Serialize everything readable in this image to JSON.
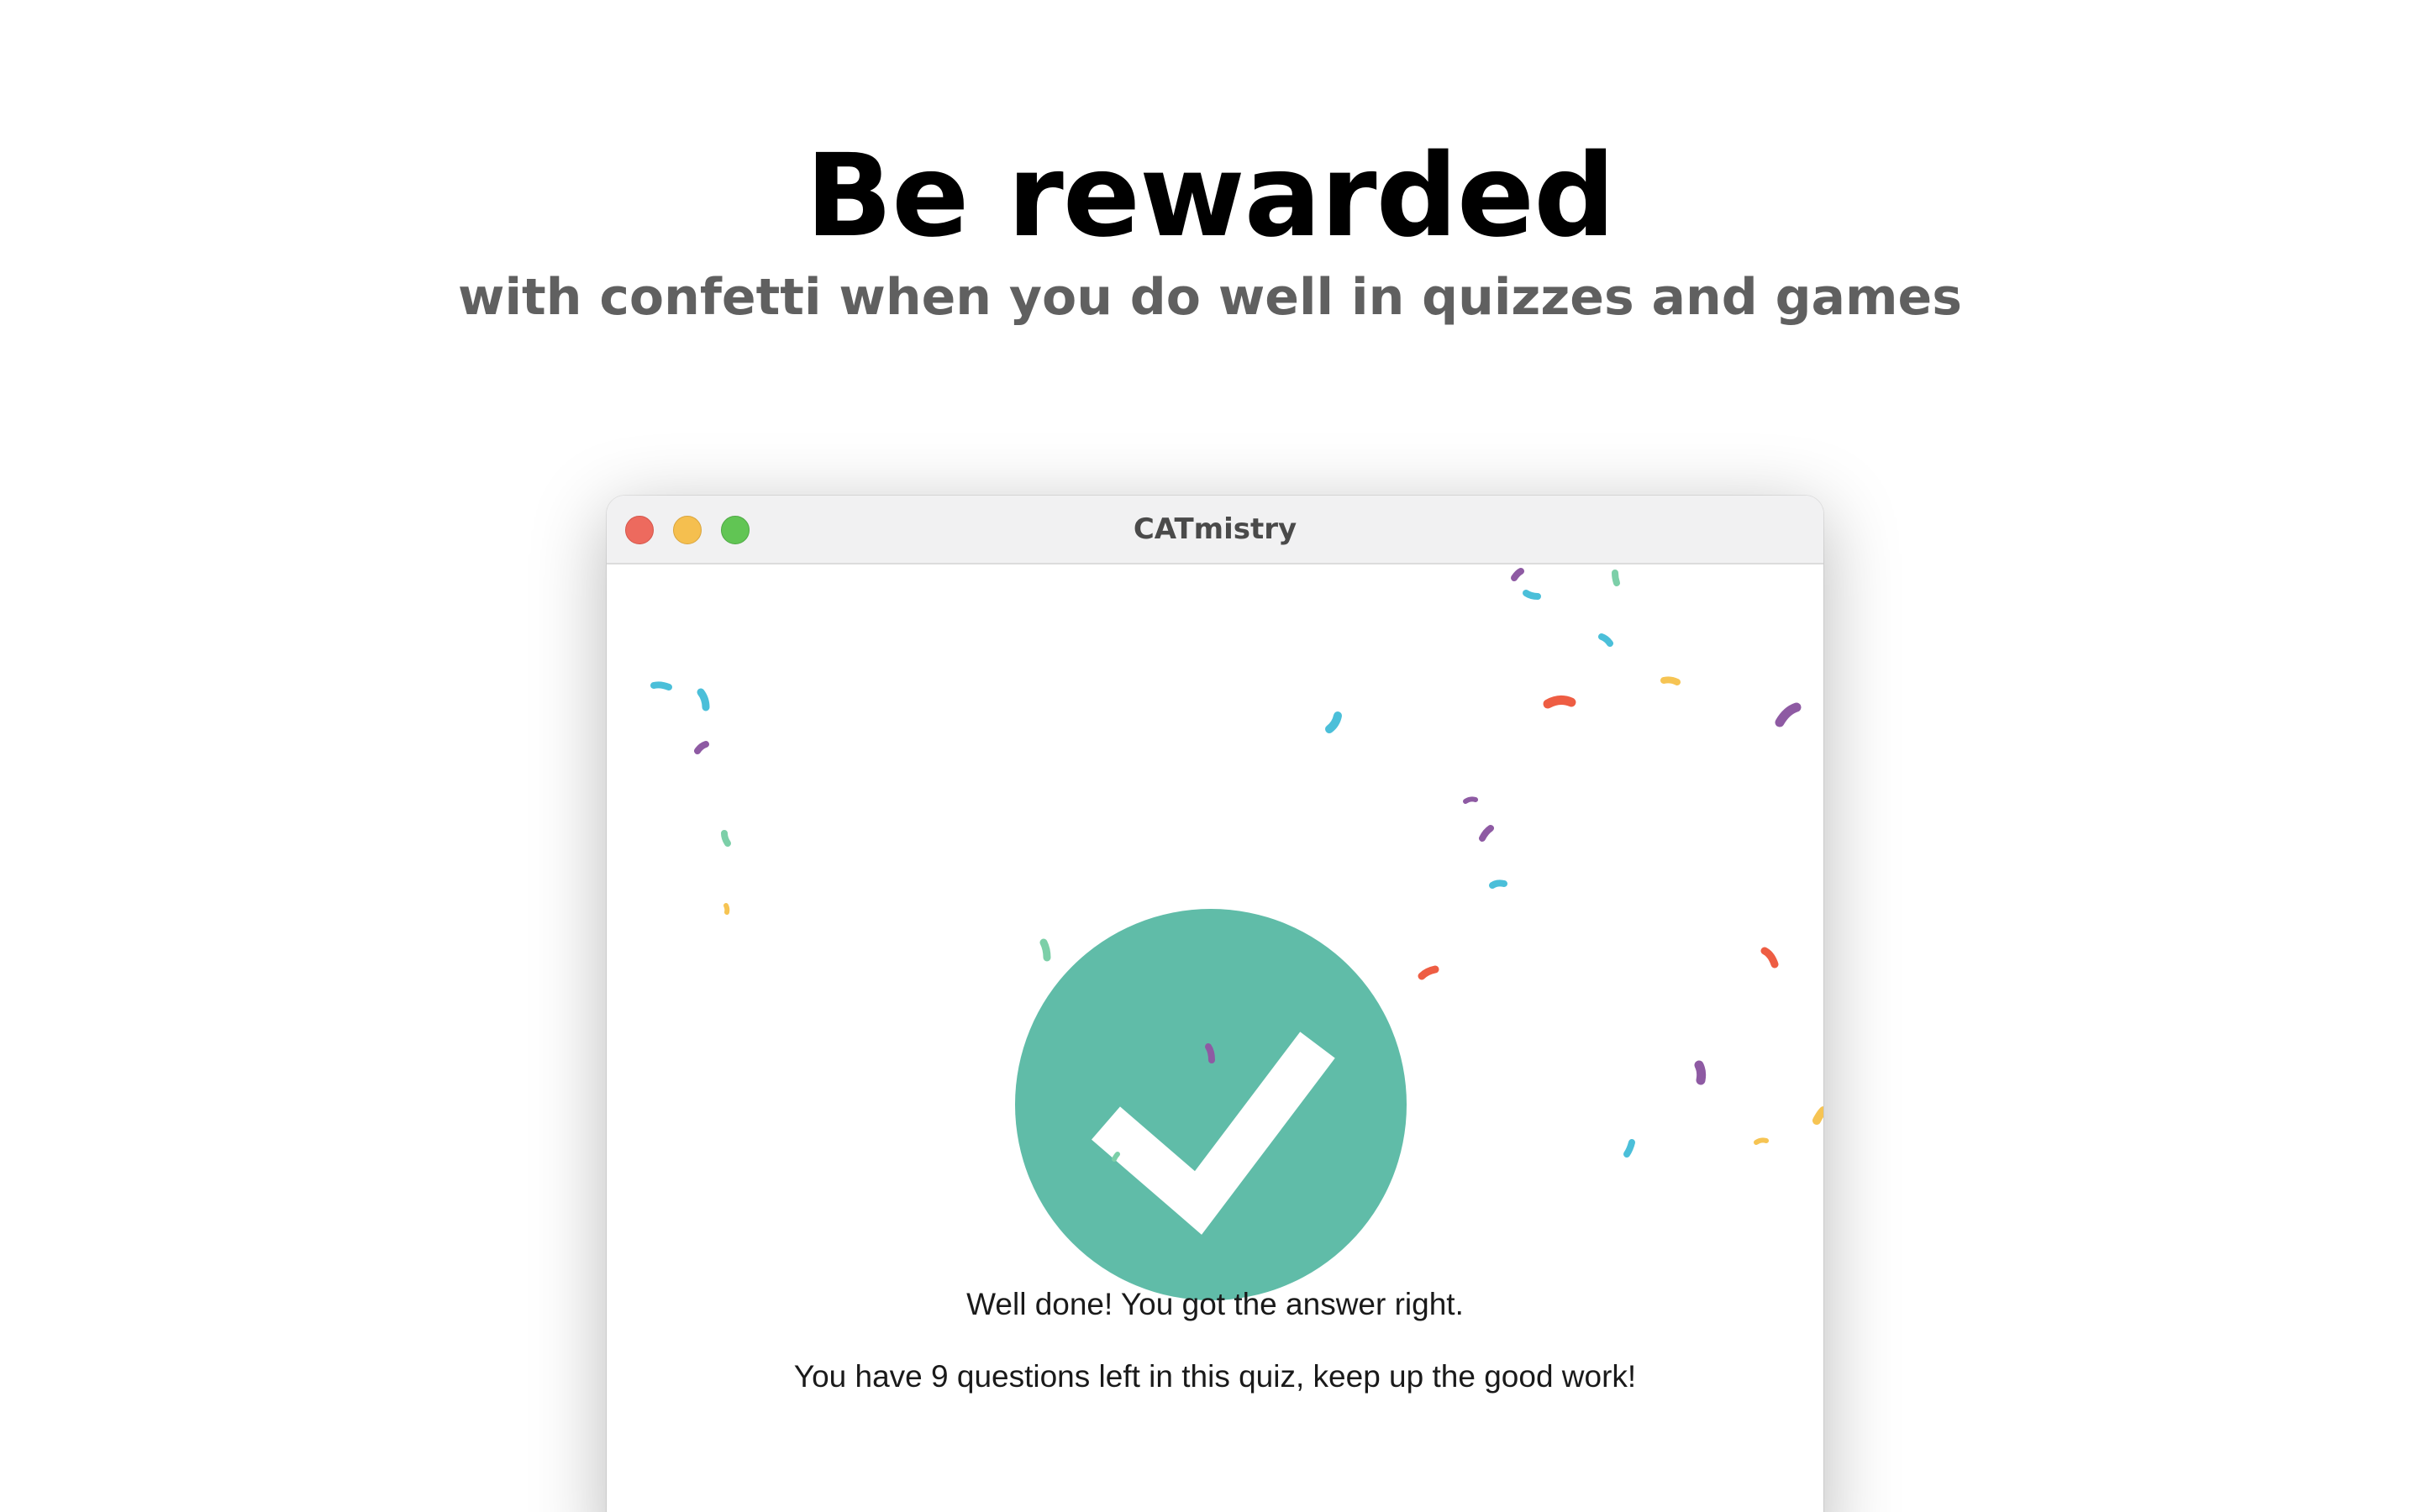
{
  "hero": {
    "headline": "Be rewarded",
    "subheadline": "with confetti when you do well in quizzes and games"
  },
  "window": {
    "title": "CATmistry",
    "traffic_lights": {
      "close": "#ed6a5e",
      "minimize": "#f5bf4f",
      "zoom": "#61c554"
    }
  },
  "result": {
    "icon": "checkmark-circle-icon",
    "icon_color": "#60bca8",
    "message": "Well done! You got the answer right.",
    "progress_message": "You have 9 questions left in this quiz, keep up the good work!"
  },
  "confetti_colors": {
    "cyan": "#4bbfd9",
    "purple": "#8e5aa3",
    "green": "#7ccfa8",
    "yellow": "#f6c453",
    "red": "#ee5d43"
  }
}
